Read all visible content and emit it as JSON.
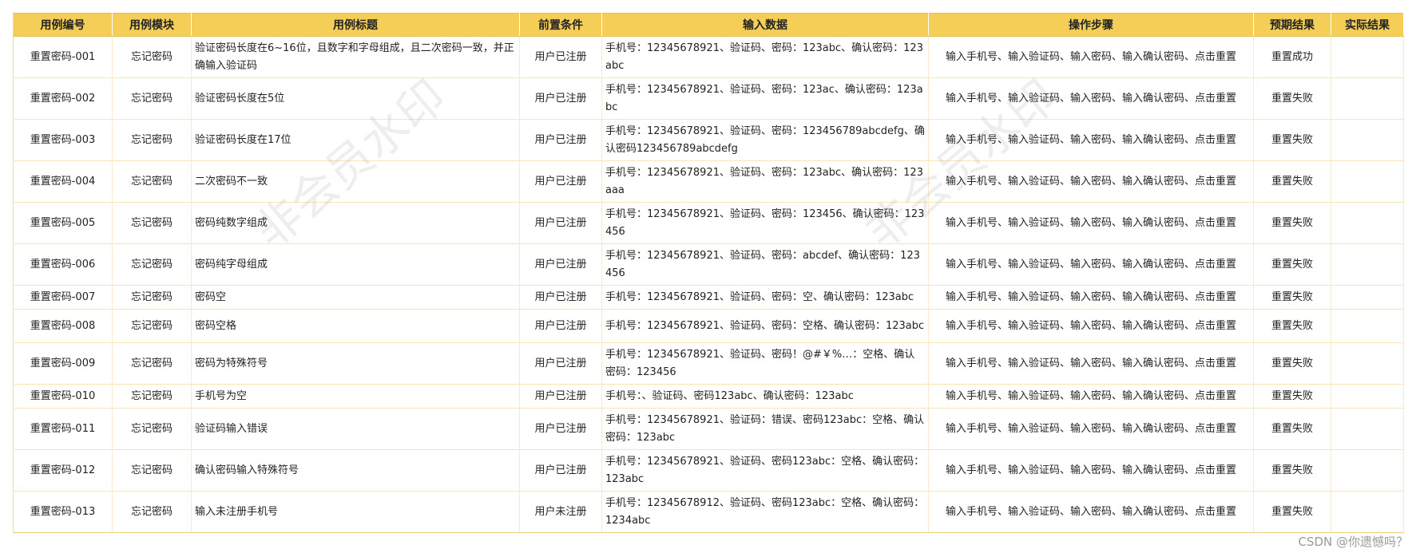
{
  "headers": [
    "用例编号",
    "用例模块",
    "用例标题",
    "前置条件",
    "输入数据",
    "操作步骤",
    "预期结果",
    "实际结果"
  ],
  "rows": [
    {
      "id": "重置密码-001",
      "module": "忘记密码",
      "title": "验证密码长度在6~16位，且数字和字母组成，且二次密码一致，并正确输入验证码",
      "pre": "用户已注册",
      "input": "手机号：12345678921、验证码、密码：123abc、确认密码：123abc",
      "steps": "输入手机号、输入验证码、输入密码、输入确认密码、点击重置",
      "expected": "重置成功",
      "actual": ""
    },
    {
      "id": "重置密码-002",
      "module": "忘记密码",
      "title": "验证密码长度在5位",
      "pre": "用户已注册",
      "input": "手机号：12345678921、验证码、密码：123ac、确认密码：123abc",
      "steps": "输入手机号、输入验证码、输入密码、输入确认密码、点击重置",
      "expected": "重置失败",
      "actual": ""
    },
    {
      "id": "重置密码-003",
      "module": "忘记密码",
      "title": "验证密码长度在17位",
      "pre": "用户已注册",
      "input": "手机号：12345678921、验证码、密码：123456789abcdefg、确认密码123456789abcdefg",
      "steps": "输入手机号、输入验证码、输入密码、输入确认密码、点击重置",
      "expected": "重置失败",
      "actual": ""
    },
    {
      "id": "重置密码-004",
      "module": "忘记密码",
      "title": "二次密码不一致",
      "pre": "用户已注册",
      "input": "手机号：12345678921、验证码、密码：123abc、确认密码：123aaa",
      "steps": "输入手机号、输入验证码、输入密码、输入确认密码、点击重置",
      "expected": "重置失败",
      "actual": ""
    },
    {
      "id": "重置密码-005",
      "module": "忘记密码",
      "title": "密码纯数字组成",
      "pre": "用户已注册",
      "input": "手机号：12345678921、验证码、密码：123456、确认密码：123456",
      "steps": "输入手机号、输入验证码、输入密码、输入确认密码、点击重置",
      "expected": "重置失败",
      "actual": ""
    },
    {
      "id": "重置密码-006",
      "module": "忘记密码",
      "title": "密码纯字母组成",
      "pre": "用户已注册",
      "input": "手机号：12345678921、验证码、密码：abcdef、确认密码：123456",
      "steps": "输入手机号、输入验证码、输入密码、输入确认密码、点击重置",
      "expected": "重置失败",
      "actual": ""
    },
    {
      "id": "重置密码-007",
      "module": "忘记密码",
      "title": "密码空",
      "pre": "用户已注册",
      "input": "手机号：12345678921、验证码、密码：空、确认密码：123abc",
      "steps": "输入手机号、输入验证码、输入密码、输入确认密码、点击重置",
      "expected": "重置失败",
      "actual": ""
    },
    {
      "id": "重置密码-008",
      "module": "忘记密码",
      "title": "密码空格",
      "pre": "用户已注册",
      "input": "手机号：12345678921、验证码、密码：空格、确认密码：123abc",
      "steps": "输入手机号、输入验证码、输入密码、输入确认密码、点击重置",
      "expected": "重置失败",
      "actual": ""
    },
    {
      "id": "重置密码-009",
      "module": "忘记密码",
      "title": "密码为特殊符号",
      "pre": "用户已注册",
      "input": "手机号：12345678921、验证码、密码！@#￥%…：空格、确认密码：123456",
      "steps": "输入手机号、输入验证码、输入密码、输入确认密码、点击重置",
      "expected": "重置失败",
      "actual": ""
    },
    {
      "id": "重置密码-010",
      "module": "忘记密码",
      "title": "手机号为空",
      "pre": "用户已注册",
      "input": "手机号：、验证码、密码123abc、确认密码：123abc",
      "steps": "输入手机号、输入验证码、输入密码、输入确认密码、点击重置",
      "expected": "重置失败",
      "actual": ""
    },
    {
      "id": "重置密码-011",
      "module": "忘记密码",
      "title": "验证码输入错误",
      "pre": "用户已注册",
      "input": "手机号：12345678921、验证码：错误、密码123abc：空格、确认密码：123abc",
      "steps": "输入手机号、输入验证码、输入密码、输入确认密码、点击重置",
      "expected": "重置失败",
      "actual": ""
    },
    {
      "id": "重置密码-012",
      "module": "忘记密码",
      "title": "确认密码输入特殊符号",
      "pre": "用户已注册",
      "input": "手机号：12345678921、验证码、密码123abc：空格、确认密码：123abc",
      "steps": "输入手机号、输入验证码、输入密码、输入确认密码、点击重置",
      "expected": "重置失败",
      "actual": ""
    },
    {
      "id": "重置密码-013",
      "module": "忘记密码",
      "title": "输入未注册手机号",
      "pre": "用户未注册",
      "input": "手机号：12345678912、验证码、密码123abc：空格、确认密码：1234abc",
      "steps": "输入手机号、输入验证码、输入密码、输入确认密码、点击重置",
      "expected": "重置失败",
      "actual": ""
    }
  ],
  "watermark": "非会员水印",
  "credit": "CSDN @你遗憾吗？",
  "colors": {
    "header_bg": "#f4ce57",
    "row_border": "#f6e7b3"
  }
}
